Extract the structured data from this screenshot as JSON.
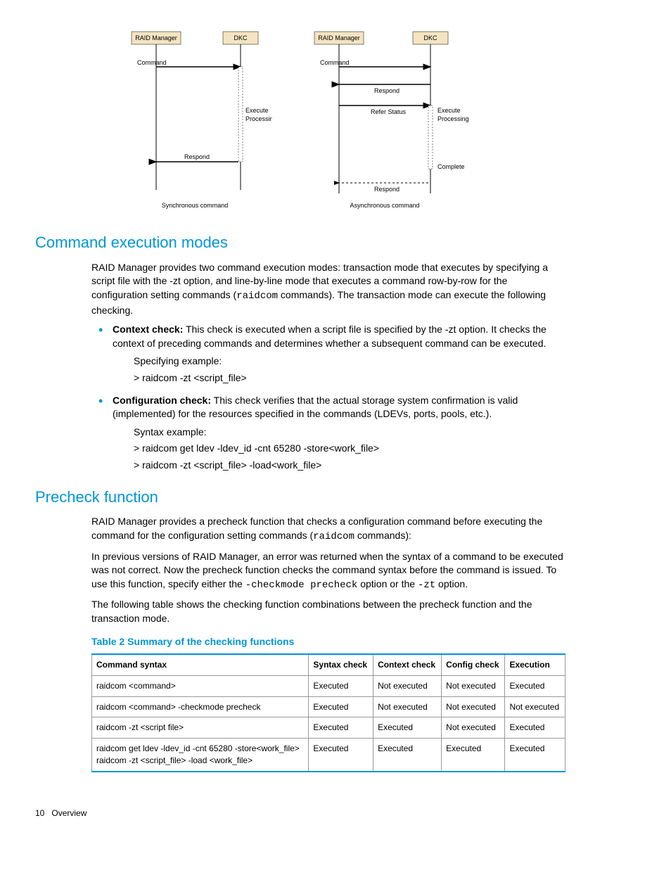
{
  "diagram": {
    "sync": {
      "box_left": "RAID Manager",
      "box_right": "DKC",
      "labels": {
        "command": "Command",
        "execute": "Execute\nProcessing",
        "respond": "Respond"
      },
      "caption": "Synchronous command"
    },
    "async": {
      "box_left": "RAID Manager",
      "box_right": "DKC",
      "labels": {
        "command": "Command",
        "respond1": "Respond",
        "refer": "Refer Status",
        "execute": "Execute\nProcessing",
        "complete": "Complete",
        "respond2": "Respond"
      },
      "caption": "Asynchronous command"
    }
  },
  "section1": {
    "title": "Command execution modes",
    "intro_a": "RAID Manager provides two command execution modes: transaction mode that executes by specifying a script file with the -zt option, and line-by-line mode that executes a command row-by-row for the configuration setting commands (",
    "intro_code": "raidcom",
    "intro_b": " commands). The transaction mode can execute the following checking.",
    "bullets": [
      {
        "label": "Context check:",
        "text": " This check is executed when a script file is specified by the -zt option. It checks the context of preceding commands and determines whether a subsequent command can be executed.",
        "sub": [
          "Specifying example:",
          "> raidcom -zt <script_file>"
        ]
      },
      {
        "label": "Configuration check:",
        "text": " This check verifies that the actual storage system confirmation is valid (implemented) for the resources specified in the commands (LDEVs, ports, pools, etc.).",
        "sub": [
          "Syntax example:",
          "> raidcom get ldev -ldev_id -cnt 65280 -store<work_file>",
          "> raidcom -zt <script_file> -load<work_file>"
        ]
      }
    ]
  },
  "section2": {
    "title": "Precheck function",
    "p1_a": "RAID Manager provides a precheck function that checks a configuration command before executing the command for the configuration setting commands (",
    "p1_code": "raidcom",
    "p1_b": " commands):",
    "p2_a": "In previous versions of RAID Manager, an error was returned when the syntax of a command to be executed was not correct. Now the precheck function checks the command syntax before the command is issued. To use this function, specify either the ",
    "p2_code1": "-checkmode precheck",
    "p2_mid": " option or the ",
    "p2_code2": "-zt",
    "p2_b": " option.",
    "p3": "The following table shows the checking function combinations between the precheck function and the transaction mode."
  },
  "table": {
    "title": "Table 2 Summary of the checking functions",
    "headers": [
      "Command syntax",
      "Syntax check",
      "Context check",
      "Config check",
      "Execution"
    ],
    "rows": [
      [
        "raidcom <command>",
        "Executed",
        "Not executed",
        "Not executed",
        "Executed"
      ],
      [
        "raidcom <command> -checkmode precheck",
        "Executed",
        "Not executed",
        "Not executed",
        "Not executed"
      ],
      [
        "raidcom -zt <script file>",
        "Executed",
        "Executed",
        "Not executed",
        "Executed"
      ],
      [
        "raidcom get ldev -ldev_id -cnt 65280 -store<work_file>\nraidcom -zt <script_file> -load <work_file>",
        "Executed",
        "Executed",
        "Executed",
        "Executed"
      ]
    ]
  },
  "footer": {
    "page": "10",
    "chapter": "Overview"
  },
  "chart_data": [
    {
      "type": "sequence-diagram",
      "title": "Synchronous command",
      "participants": [
        "RAID Manager",
        "DKC"
      ],
      "messages": [
        {
          "from": "RAID Manager",
          "to": "DKC",
          "label": "Command",
          "style": "solid"
        },
        {
          "note": "Execute Processing",
          "at": "DKC"
        },
        {
          "from": "DKC",
          "to": "RAID Manager",
          "label": "Respond",
          "style": "solid"
        }
      ]
    },
    {
      "type": "sequence-diagram",
      "title": "Asynchronous command",
      "participants": [
        "RAID Manager",
        "DKC"
      ],
      "messages": [
        {
          "from": "RAID Manager",
          "to": "DKC",
          "label": "Command",
          "style": "solid"
        },
        {
          "from": "DKC",
          "to": "RAID Manager",
          "label": "Respond",
          "style": "solid"
        },
        {
          "from": "RAID Manager",
          "to": "DKC",
          "label": "Refer Status",
          "style": "solid"
        },
        {
          "note": "Execute Processing",
          "at": "DKC"
        },
        {
          "note": "Complete",
          "at": "DKC"
        },
        {
          "from": "DKC",
          "to": "RAID Manager",
          "label": "Respond",
          "style": "dashed"
        }
      ]
    }
  ]
}
